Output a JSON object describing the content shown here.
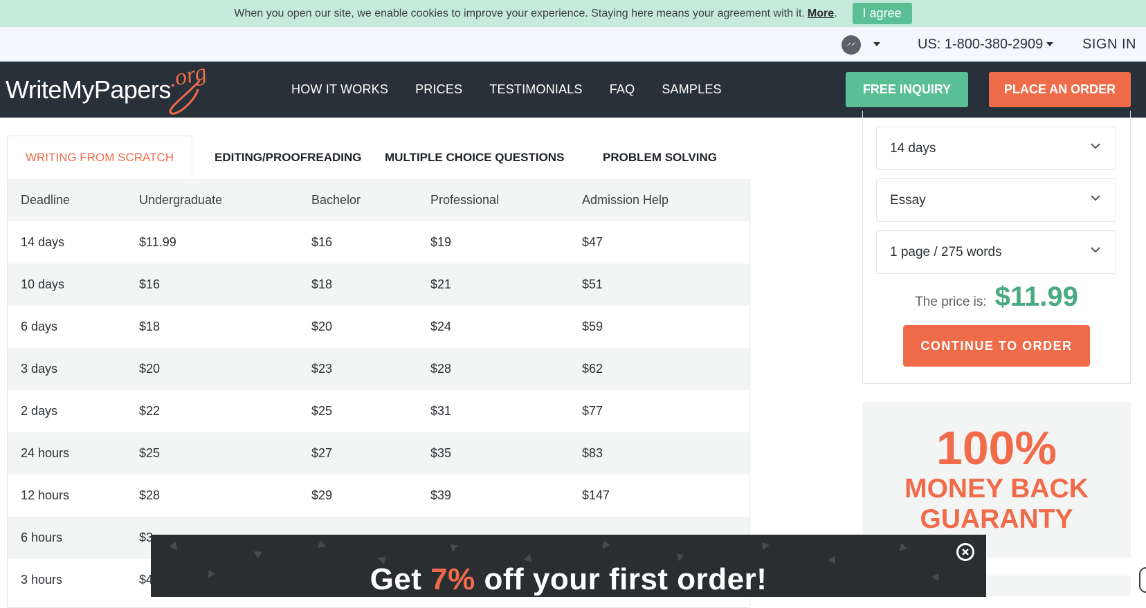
{
  "cookie": {
    "text": "When you open our site, we enable cookies to improve your experience. Staying here means your agreement with it.",
    "more": "More",
    "agree": "I agree"
  },
  "util": {
    "phone": "US: 1-800-380-2909",
    "signin": "SIGN IN",
    "messenger_icon": "messenger-icon"
  },
  "logo": {
    "word": "WriteMyPapers",
    "org": ".org"
  },
  "nav": {
    "items": [
      "HOW IT WORKS",
      "PRICES",
      "TESTIMONIALS",
      "FAQ",
      "SAMPLES"
    ],
    "inquiry": "FREE INQUIRY",
    "order": "PLACE AN ORDER"
  },
  "tabs": [
    "WRITING FROM SCRATCH",
    "EDITING/PROOFREADING",
    "MULTIPLE CHOICE QUESTIONS",
    "PROBLEM SOLVING"
  ],
  "table": {
    "headers": [
      "Deadline",
      "Undergraduate",
      "Bachelor",
      "Professional",
      "Admission Help"
    ],
    "rows": [
      [
        "14 days",
        "$11.99",
        "$16",
        "$19",
        "$47"
      ],
      [
        "10 days",
        "$16",
        "$18",
        "$21",
        "$51"
      ],
      [
        "6 days",
        "$18",
        "$20",
        "$24",
        "$59"
      ],
      [
        "3 days",
        "$20",
        "$23",
        "$28",
        "$62"
      ],
      [
        "2 days",
        "$22",
        "$25",
        "$31",
        "$77"
      ],
      [
        "24 hours",
        "$25",
        "$27",
        "$35",
        "$83"
      ],
      [
        "12 hours",
        "$28",
        "$29",
        "$39",
        "$147"
      ],
      [
        "6 hours",
        "$3",
        "",
        "",
        ""
      ],
      [
        "3 hours",
        "$4",
        "",
        "",
        ""
      ]
    ]
  },
  "calculator": {
    "deadline": "14 days",
    "type": "Essay",
    "pages": "1 page / 275 words",
    "price_label": "The price is:",
    "price": "$11.99",
    "continue": "CONTINUE TO ORDER"
  },
  "guarantee": {
    "percent": "100%",
    "line1": "MONEY BACK",
    "line2": "GUARANTY"
  },
  "promo": {
    "pre": "Get ",
    "pct": "7%",
    "post": " off your first order!"
  },
  "colors": {
    "accent": "#f06b4a",
    "green": "#5bbf96",
    "nav": "#283139"
  }
}
